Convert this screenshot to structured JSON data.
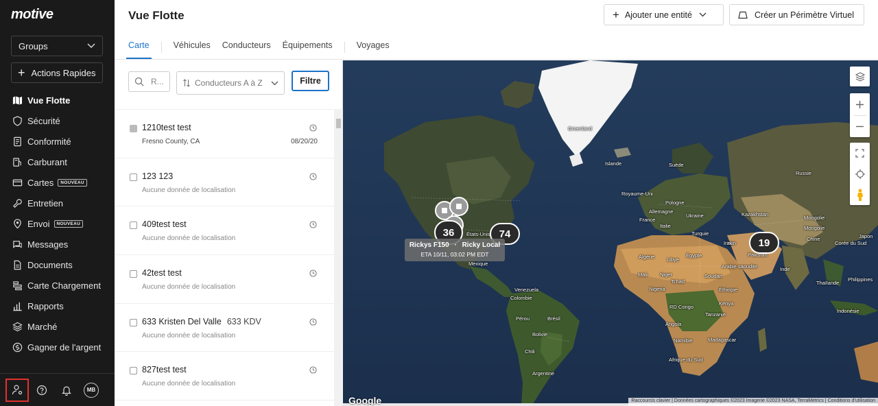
{
  "sidebar": {
    "logo": "motive",
    "groups_label": "Groups",
    "quick_actions_label": "Actions Rapides",
    "items": [
      {
        "label": "Vue Flotte",
        "icon": "map-icon",
        "active": true
      },
      {
        "label": "Sécurité",
        "icon": "shield-icon"
      },
      {
        "label": "Conformité",
        "icon": "document-icon"
      },
      {
        "label": "Carburant",
        "icon": "fuel-icon"
      },
      {
        "label": "Cartes",
        "icon": "card-icon",
        "badge": "NOUVEAU"
      },
      {
        "label": "Entretien",
        "icon": "wrench-icon"
      },
      {
        "label": "Envoi",
        "icon": "location-icon",
        "badge": "NOUVEAU"
      },
      {
        "label": "Messages",
        "icon": "chat-icon"
      },
      {
        "label": "Documents",
        "icon": "file-icon"
      },
      {
        "label": "Carte Chargement",
        "icon": "load-icon"
      },
      {
        "label": "Rapports",
        "icon": "chart-icon"
      },
      {
        "label": "Marché",
        "icon": "layers-icon"
      },
      {
        "label": "Gagner de l'argent",
        "icon": "dollar-icon"
      }
    ],
    "footer": {
      "avatar_initials": "MB"
    }
  },
  "header": {
    "title": "Vue Flotte",
    "add_entity_label": "Ajouter une entité",
    "geofence_label": "Créer un Périmètre Virtuel",
    "tabs": [
      {
        "label": "Carte",
        "active": true
      },
      {
        "label": "Véhicules"
      },
      {
        "label": "Conducteurs"
      },
      {
        "label": "Équipements"
      },
      {
        "label": "Voyages"
      }
    ]
  },
  "list_panel": {
    "search_placeholder": "R...",
    "sort_label": "Conducteurs A à Z",
    "filter_label": "Filtre",
    "rows": [
      {
        "name": "1210test test",
        "extra": "",
        "sub": "Fresno County, CA",
        "date": "08/20/20",
        "filled": true
      },
      {
        "name": "123 123",
        "extra": "",
        "sub": "Aucune donnée de localisation",
        "date": ""
      },
      {
        "name": "409test test",
        "extra": "",
        "sub": "Aucune donnée de localisation",
        "date": ""
      },
      {
        "name": "42test test",
        "extra": "",
        "sub": "Aucune donnée de localisation",
        "date": ""
      },
      {
        "name": "633 Kristen Del Valle",
        "extra": "633 KDV",
        "sub": "Aucune donnée de localisation",
        "date": ""
      },
      {
        "name": "827test test",
        "extra": "",
        "sub": "Aucune donnée de localisation",
        "date": ""
      }
    ]
  },
  "map": {
    "clusters": [
      {
        "count": "36"
      },
      {
        "count": "74"
      },
      {
        "count": "19"
      }
    ],
    "tooltip": {
      "title_a": "Rickys F150",
      "sep": "·",
      "title_b": "Ricky Local",
      "eta": "ETA 10/11, 03:02 PM EDT"
    },
    "labels": [
      "Groenland",
      "Islande",
      "Suède",
      "Russie",
      "Royaume-Uni",
      "Allemagne",
      "Pologne",
      "Kazakhstan",
      "France",
      "Italie",
      "Mongolie",
      "Turquie",
      "Chine",
      "Iran",
      "Pakistan",
      "Inde",
      "États-Unis",
      "Mexique",
      "Algérie",
      "Libye",
      "Égypte",
      "Mali",
      "Niger",
      "Tchad",
      "Soudan",
      "Nigeria",
      "Éthiopie",
      "Kenya",
      "RD Congo",
      "Tanzanie",
      "Angola",
      "Venezuela",
      "Colombie",
      "Pérou",
      "Brésil",
      "Bolivie",
      "Chili",
      "Argentine",
      "Namibie",
      "Afrique du Sud",
      "Madagascar",
      "Indonésie",
      "Japon",
      "Corée du Sud",
      "Philippines",
      "Thaïlande",
      "Arabie saoudite",
      "Irak",
      "Ukraine",
      "Mongolie"
    ],
    "logo": "Google",
    "attribution": "Raccourcis clavier  |  Données cartographiques ©2023 Imagerie ©2023 NASA, TerraMetrics  |  Conditions d'utilisation"
  }
}
